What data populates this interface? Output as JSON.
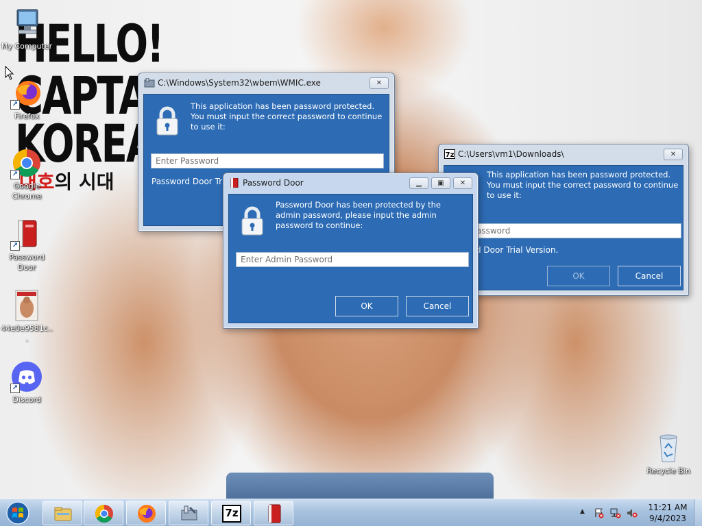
{
  "desktop": {
    "poster": {
      "line1": "HELLO!",
      "line2": "CAPTAI",
      "line3": "KOREA",
      "korean_red": "대호",
      "korean_rest": "의 시대"
    },
    "icons": [
      {
        "label": "My Computer",
        "icon": "computer-icon"
      },
      {
        "label": "Firefox",
        "icon": "firefox-icon"
      },
      {
        "label": "Google Chrome",
        "icon": "chrome-icon"
      },
      {
        "label": "Password Door",
        "icon": "password-door-icon"
      },
      {
        "label": "44e0e9581c...",
        "icon": "image-thumbnail-icon"
      },
      {
        "label": "Discord",
        "icon": "discord-icon"
      },
      {
        "label": "Recycle Bin",
        "icon": "recycle-bin-icon"
      }
    ]
  },
  "windows": {
    "wmic": {
      "title": "C:\\Windows\\System32\\wbem\\WMIC.exe",
      "message": "This application has been password protected. You must input the correct password to continue to use it:",
      "input_placeholder": "Enter Password",
      "trial_text": "Password Door Trial"
    },
    "downloads": {
      "title": "C:\\Users\\vm1\\Downloads\\",
      "message": "This application has been password protected. You must input the correct password to continue to use it:",
      "input_placeholder": "assword",
      "trial_text": "d Door Trial Version.",
      "ok_label": "OK",
      "cancel_label": "Cancel"
    },
    "password_door": {
      "title": "Password Door",
      "message": "Password Door has been protected by the admin password, please input the admin password to continue:",
      "input_placeholder": "Enter Admin Password",
      "ok_label": "OK",
      "cancel_label": "Cancel"
    }
  },
  "taskbar": {
    "pinned": [
      "windows-explorer-icon",
      "chrome-icon",
      "firefox-icon",
      "wmic-tool-icon",
      "7zip-icon",
      "password-door-icon"
    ],
    "seven_zip_label": "7z",
    "clock_time": "11:21 AM",
    "clock_date": "9/4/2023"
  }
}
